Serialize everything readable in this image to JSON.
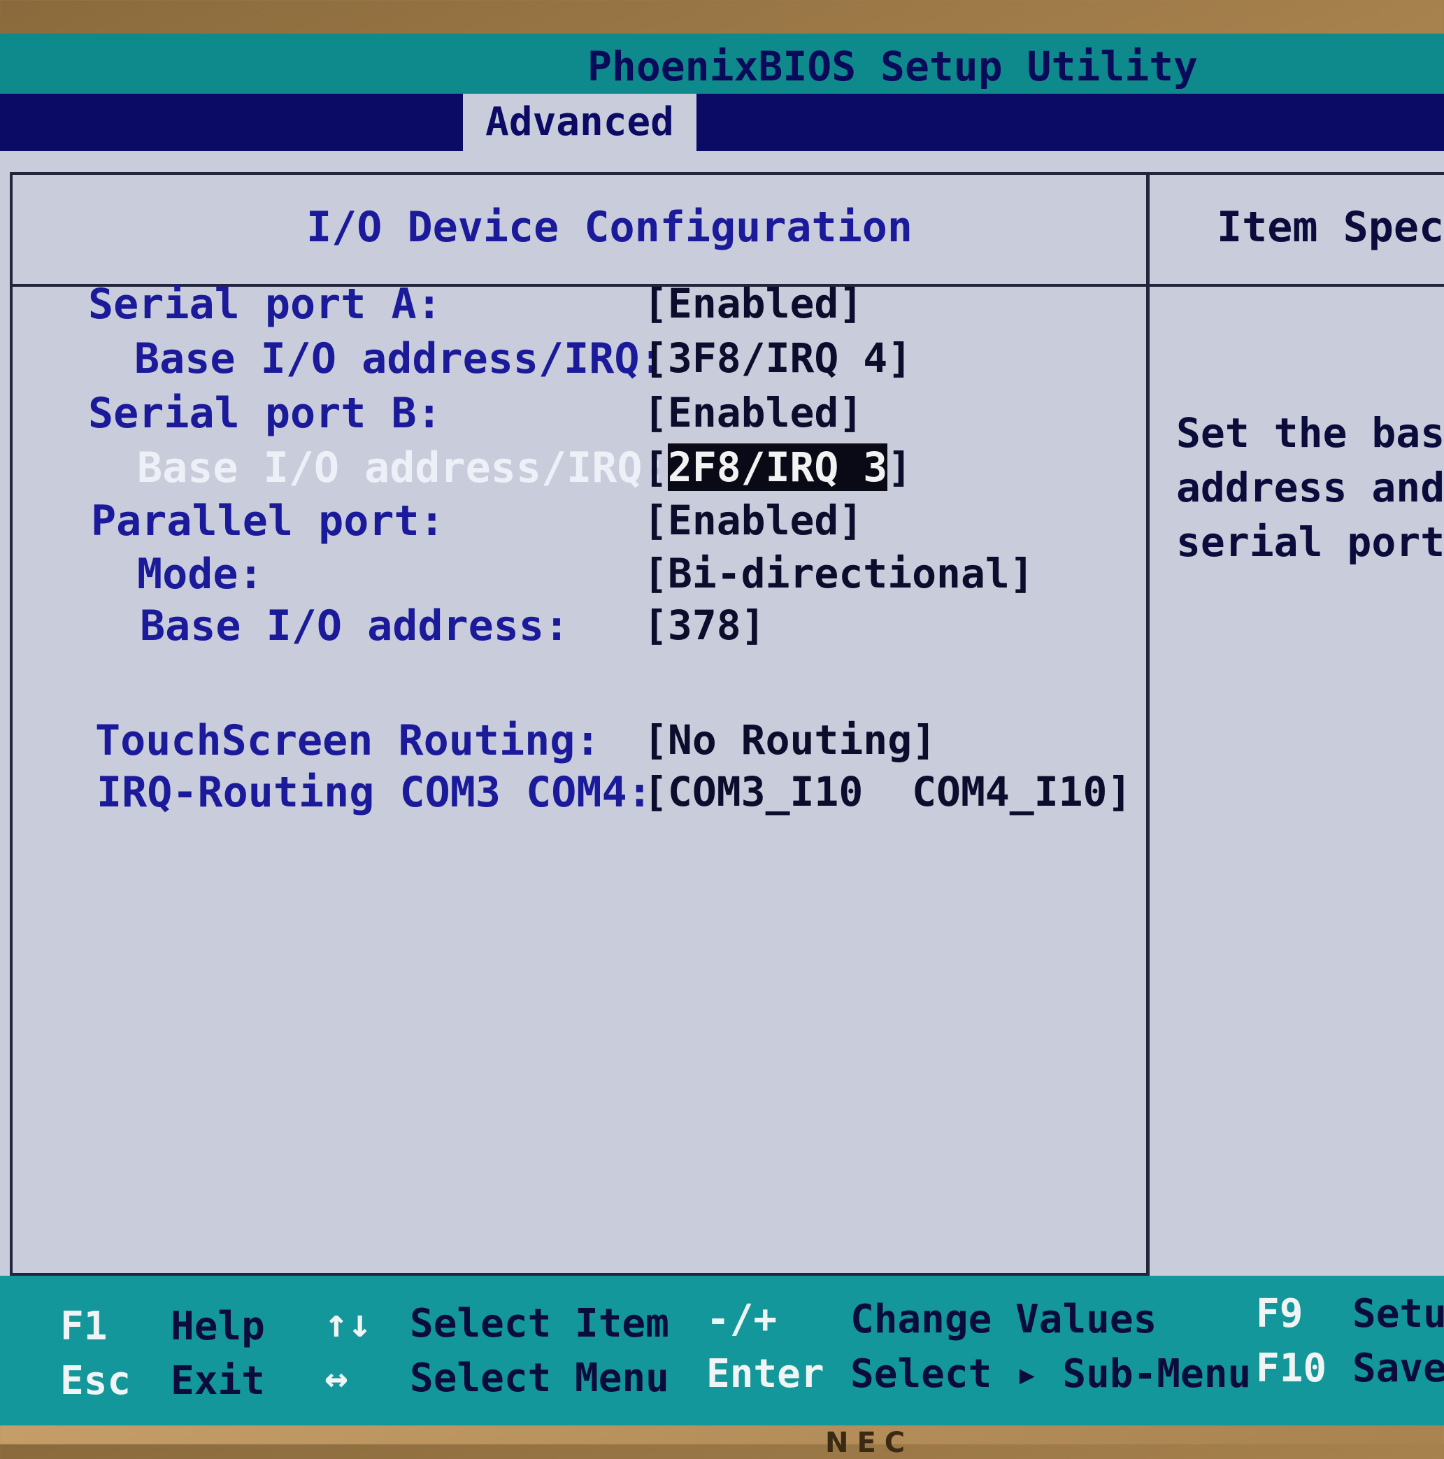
{
  "app_title": "PhoenixBIOS Setup Utility",
  "menu": {
    "active_tab": "Advanced"
  },
  "panel": {
    "title": "I/O Device Configuration"
  },
  "help": {
    "title": "Item Specif",
    "lines": [
      "Set the base I",
      "address and IR",
      "serial port B"
    ]
  },
  "settings": [
    {
      "label": "Serial port A:",
      "value": "[Enabled]"
    },
    {
      "label": "Base I/O address/IRQ:",
      "value": "[3F8/IRQ 4]"
    },
    {
      "label": "Serial port B:",
      "value": "[Enabled]"
    },
    {
      "label": "Base I/O address/IRQ:",
      "value_open": "[",
      "value_selected": "2F8/IRQ 3",
      "value_close": "]"
    },
    {
      "label": "Parallel port:",
      "value": "[Enabled]"
    },
    {
      "label": "Mode:",
      "value": "[Bi-directional]"
    },
    {
      "label": "Base I/O address:",
      "value": "[378]"
    },
    {
      "label": "TouchScreen Routing:",
      "value": "[No Routing]"
    },
    {
      "label": "IRQ-Routing COM3 COM4:",
      "value": "[COM3_I10  COM4_I10]"
    }
  ],
  "footer": {
    "f1_key": "F1",
    "f1_desc": "Help",
    "esc_key": "Esc",
    "esc_desc": "Exit",
    "updown_key": "↑↓",
    "updown_desc": "Select Item",
    "leftright_key": "↔",
    "leftright_desc": "Select Menu",
    "change_key": "-/+",
    "change_desc": "Change Values",
    "enter_key": "Enter",
    "enter_desc": "Select ▸ Sub-Menu",
    "f9_key": "F9",
    "f9_desc": "Setup",
    "f10_key": "F10",
    "f10_desc": "Save"
  },
  "bezel_brand": "NEC",
  "colors": {
    "title_bar": "#0f8a8c",
    "menu_bar": "#0b0b66",
    "panel_bg": "#c9ccda",
    "label_text": "#1a1a9a",
    "footer": "#14979a"
  }
}
